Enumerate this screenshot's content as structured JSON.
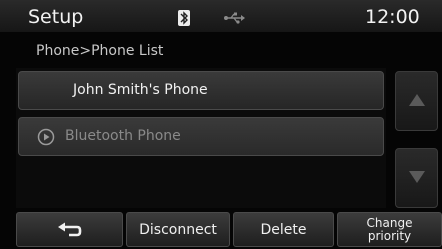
{
  "header": {
    "title": "Setup",
    "clock": "12:00"
  },
  "icons": {
    "bluetooth": "bluetooth-icon",
    "usb": "usb-icon"
  },
  "breadcrumb": "Phone>Phone List",
  "list": {
    "items": [
      {
        "label": "John Smith's Phone",
        "state": "selected"
      },
      {
        "label": "Bluetooth Phone",
        "state": "dimmed",
        "icon": "play-circle-icon"
      }
    ]
  },
  "scroll": {
    "up_icon": "triangle-up-icon",
    "down_icon": "triangle-down-icon"
  },
  "buttons": {
    "back_icon": "back-arrow-icon",
    "disconnect": "Disconnect",
    "delete": "Delete",
    "change_priority_line1": "Change",
    "change_priority_line2": "priority"
  },
  "colors": {
    "background": "#050505",
    "text": "#f2f2f2",
    "dimmed_text": "#8a8a8a"
  }
}
